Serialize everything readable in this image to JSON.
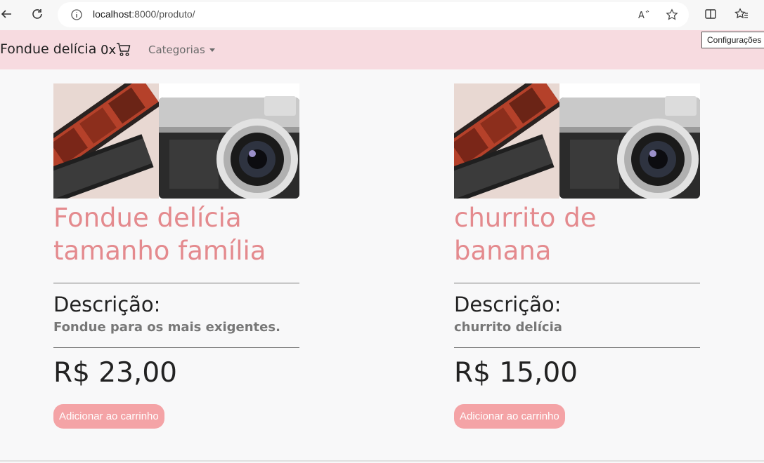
{
  "browser": {
    "url_host": "localhost",
    "url_port_path": ":8000/produto/",
    "tooltip": "Configurações e"
  },
  "navbar": {
    "brand": "Fondue delícia",
    "cart_count": "0x",
    "categories_label": "Categorias"
  },
  "products": [
    {
      "title": "Fondue delícia tamanho família",
      "description_label": "Descrição:",
      "description": "Fondue para os mais exigentes.",
      "price": "R$ 23,00",
      "add_button": "Adicionar ao carrinho"
    },
    {
      "title": "churrito de banana",
      "description_label": "Descrição:",
      "description": "churrito delícia",
      "price": "R$ 15,00",
      "add_button": "Adicionar ao carrinho"
    }
  ]
}
